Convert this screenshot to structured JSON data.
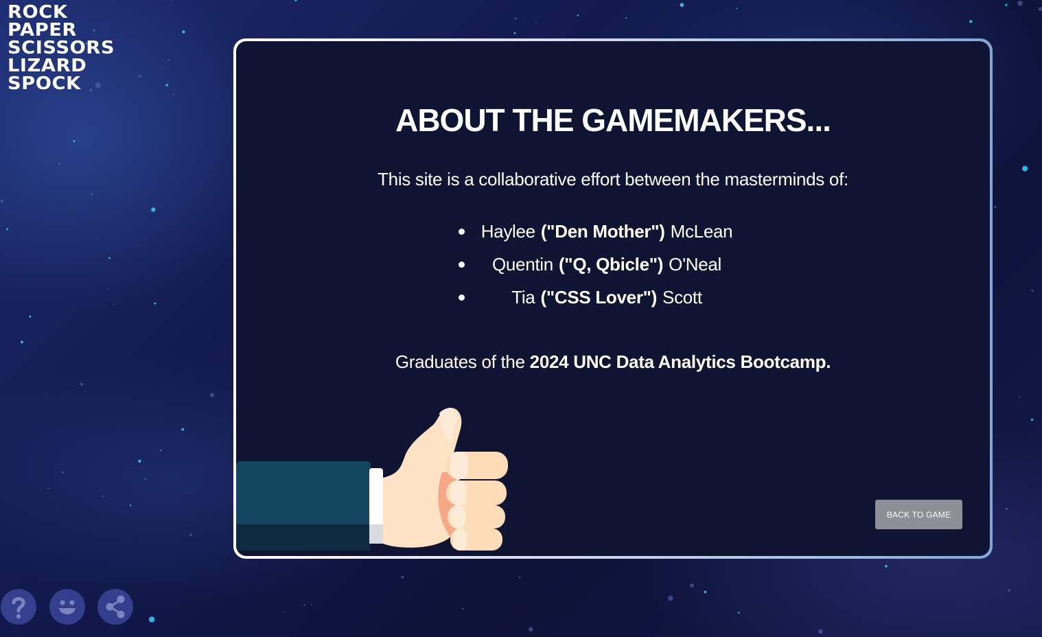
{
  "logo": {
    "lines": [
      "ROCK",
      "PAPER",
      "SCISSORS",
      "LIZARD",
      "SPOCK"
    ]
  },
  "about": {
    "title": "ABOUT THE GAMEMAKERS...",
    "intro": "This site is a collaborative effort between the masterminds of:",
    "members": [
      {
        "first": "Haylee",
        "nickname": "(\"Den Mother\")",
        "last": "McLean"
      },
      {
        "first": "Quentin",
        "nickname": "(\"Q, Qbicle\")",
        "last": "O'Neal"
      },
      {
        "first": "Tia",
        "nickname": "(\"CSS Lover\")",
        "last": "Scott"
      }
    ],
    "graduates_prefix": "Graduates of the ",
    "graduates_bold": "2024 UNC Data Analytics Bootcamp.",
    "back_button_label": "BACK TO GAME"
  },
  "bottom_icons": [
    {
      "name": "question-icon"
    },
    {
      "name": "smiley-icon"
    },
    {
      "name": "share-icon"
    }
  ],
  "colors": {
    "card_background": "#101433",
    "button_background": "#8d8f96",
    "icon_button_background": "#3a4699"
  }
}
